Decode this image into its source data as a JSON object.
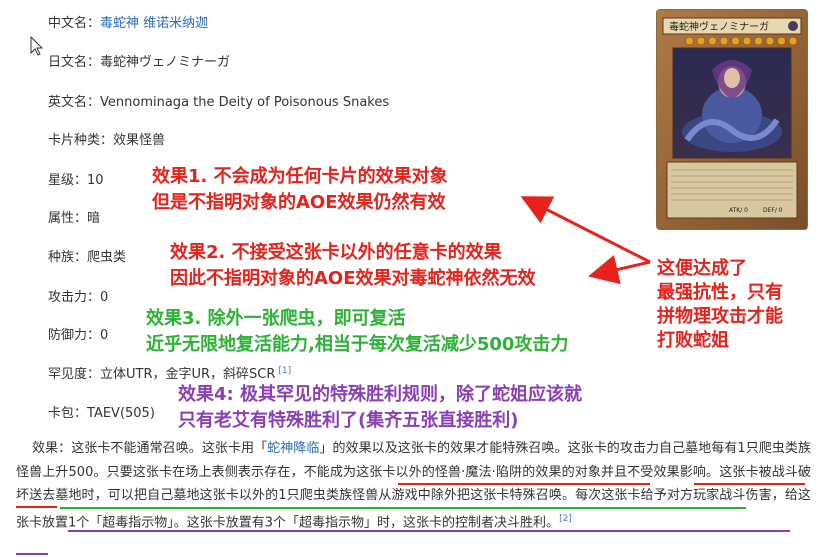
{
  "fields": [
    {
      "label": "中文名：",
      "value": "毒蛇神 维诺米纳迦",
      "is_link": true
    },
    {
      "label": "日文名：",
      "value": "毒蛇神ヴェノミナーガ"
    },
    {
      "label": "英文名：",
      "value": "Vennominaga the Deity of Poisonous Snakes"
    },
    {
      "label": "卡片种类：",
      "value": "效果怪兽"
    },
    {
      "label": "星级：",
      "value": "10"
    },
    {
      "label": "属性：",
      "value": "暗"
    },
    {
      "label": "种族：",
      "value": "爬虫类"
    },
    {
      "label": "攻击力：",
      "value": "0"
    },
    {
      "label": "防御力：",
      "value": "0"
    },
    {
      "label": "罕见度：",
      "value": "立体UTR，金字UR，斜碎SCR",
      "ref": "[1]"
    },
    {
      "label": "卡包：",
      "value": "TAEV(505)"
    }
  ],
  "card": {
    "name": "毒蛇神ヴェノミナーガ",
    "atk": "ATK/ 0",
    "def": "DEF/ 0",
    "stars": 10
  },
  "annotations": {
    "e1": [
      "效果1. 不会成为任何卡片的效果对象",
      "但是不指明对象的AOE效果仍然有效"
    ],
    "e2": [
      "效果2. 不接受这张卡以外的任意卡的效果",
      "因此不指明对象的AOE效果对毒蛇神依然无效"
    ],
    "e3": [
      "效果3. 除外一张爬虫，即可复活",
      "近乎无限地复活能力,相当于每次复活减少500攻击力"
    ],
    "e4": [
      "效果4: 极其罕见的特殊胜利规则，除了蛇姐应该就",
      "只有老艾有特殊胜利了(集齐五张直接胜利)"
    ],
    "summary": [
      "这便达成了",
      "最强抗性，只有",
      "拼物理攻击才能",
      "打败蛇姐"
    ]
  },
  "effect": {
    "p1": "效果：这张卡不能通常召唤。这张卡用「",
    "link": "蛇神降临",
    "p2": "」的效果以及这张卡的效果才能特殊召唤。这张卡的攻击力自己墓地每有1只爬虫类族怪兽上升500。只要这张卡在场上表侧表示存在，",
    "u1": "不能成为这张卡以外的怪兽·魔法·陷阱的效果的对象并且不受效果影响",
    "p3": "。",
    "u2": "这张卡被战斗破坏送去墓地时，可以把自己墓地这张卡以外的1只爬虫类族怪兽从游戏中除外把这张卡特殊召唤",
    "p4": "。每次这张卡",
    "u3": "给予对方玩家战斗伤害，给这张卡放置1个「超毒指示物」。这张卡放置有3个「超毒指示物」时，这张卡的控制者决斗胜利",
    "p5": "。",
    "ref": "[2]"
  }
}
